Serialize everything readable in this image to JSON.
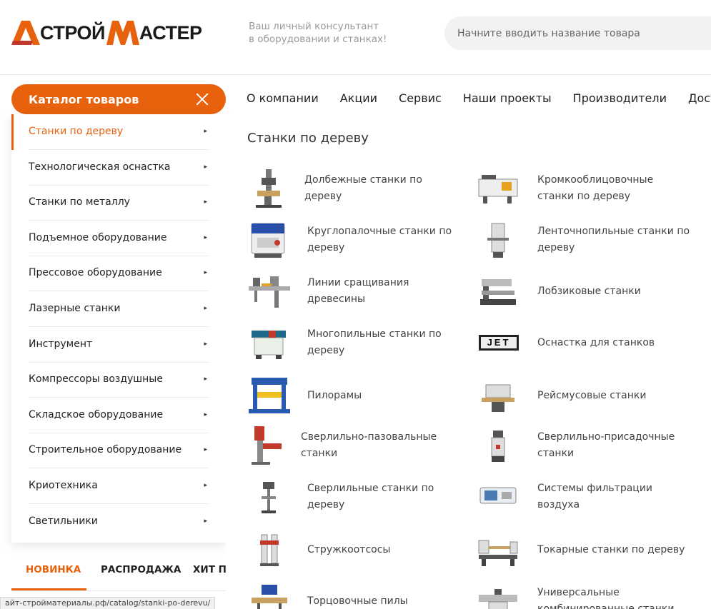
{
  "brand": {
    "logo_letter_left": "А",
    "logo_word_left": "СТРОЙ",
    "logo_letter_right": "М",
    "logo_word_right": "АСТЕР",
    "accent_color": "#e8620d",
    "tagline_line1": "Ваш личный консультант",
    "tagline_line2": "в оборудовании и станках!"
  },
  "search": {
    "placeholder": "Начните вводить название товара"
  },
  "catalog_button": {
    "label": "Каталог товаров",
    "icon": "close-icon"
  },
  "topnav": [
    "О компании",
    "Акции",
    "Сервис",
    "Наши проекты",
    "Производители",
    "Доставка"
  ],
  "sidebar": {
    "items": [
      {
        "label": "Станки по дереву",
        "active": true
      },
      {
        "label": "Технологическая оснастка"
      },
      {
        "label": "Станки по металлу"
      },
      {
        "label": "Подъемное оборудование"
      },
      {
        "label": "Прессовое оборудование"
      },
      {
        "label": "Лазерные станки"
      },
      {
        "label": "Инструмент"
      },
      {
        "label": "Компрессоры воздушные"
      },
      {
        "label": "Складское оборудование"
      },
      {
        "label": "Строительное оборудование"
      },
      {
        "label": "Криотехника"
      },
      {
        "label": "Светильники"
      }
    ],
    "chevron": "▸"
  },
  "submenu": {
    "title": "Станки по дереву",
    "items": [
      {
        "label": "Долбежные станки по дереву",
        "icon": "mortising-machine-icon"
      },
      {
        "label": "Кромкооблицовочные станки по дереву",
        "icon": "edgebander-icon"
      },
      {
        "label": "Круглопалочные станки по дереву",
        "icon": "dowel-machine-icon"
      },
      {
        "label": "Ленточнопильные станки по дереву",
        "icon": "bandsaw-icon"
      },
      {
        "label": "Линии сращивания древесины",
        "icon": "finger-joint-line-icon"
      },
      {
        "label": "Лобзиковые станки",
        "icon": "scroll-saw-icon"
      },
      {
        "label": "Многопильные станки по дереву",
        "icon": "multi-rip-saw-icon"
      },
      {
        "label": "Оснастка для станков",
        "icon": "jet-logo-icon",
        "badge": "JET"
      },
      {
        "label": "Пилорамы",
        "icon": "sawmill-icon"
      },
      {
        "label": "Рейсмусовые станки",
        "icon": "thickness-planer-icon"
      },
      {
        "label": "Сверлильно-пазовальные станки",
        "icon": "slot-mortiser-icon"
      },
      {
        "label": "Сверлильно-присадочные станки",
        "icon": "boring-machine-icon"
      },
      {
        "label": "Сверлильные станки по дереву",
        "icon": "drill-press-icon"
      },
      {
        "label": "Системы фильтрации воздуха",
        "icon": "air-filter-icon"
      },
      {
        "label": "Стружкоотсосы",
        "icon": "dust-collector-icon"
      },
      {
        "label": "Токарные станки по дереву",
        "icon": "lathe-icon"
      },
      {
        "label": "Торцовочные пилы",
        "icon": "miter-saw-icon"
      },
      {
        "label": "Универсальные комбинированные станки",
        "icon": "combination-machine-icon"
      }
    ]
  },
  "tabs": [
    "НОВИНКА",
    "РАСПРОДАЖА",
    "ХИТ ПРОДАЖ"
  ],
  "status_bar": {
    "url": "айт-строй­материалы.рф/catalog/stanki-po-derevu/"
  }
}
